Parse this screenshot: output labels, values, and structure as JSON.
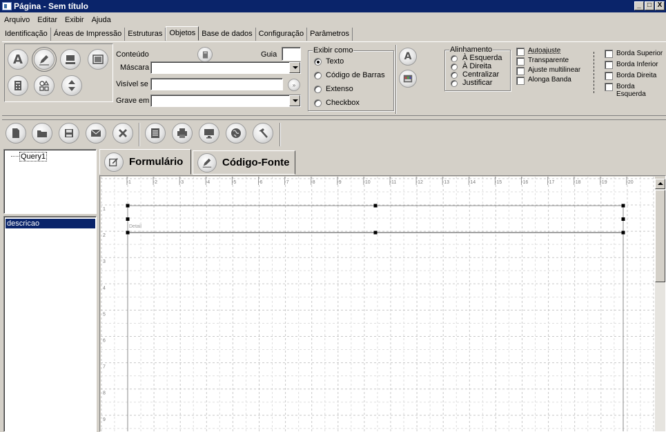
{
  "window": {
    "title": "Página - Sem título"
  },
  "window_buttons": [
    "_",
    "□",
    "X"
  ],
  "menu": [
    "Arquivo",
    "Editar",
    "Exibir",
    "Ajuda"
  ],
  "tabs": [
    "Identificação",
    "Áreas de Impressão",
    "Estruturas",
    "Objetos",
    "Base de dados",
    "Configuração",
    "Parâmetros"
  ],
  "active_tab": "Objetos",
  "object_tools": [
    "text-tool",
    "pencil-tool",
    "computer-tool",
    "image-tool",
    "calculator-tool",
    "shapes-tool",
    "arrows-tool"
  ],
  "props": {
    "conteudo_label": "Conteúdo",
    "guia_label": "Guia",
    "mascara_label": "Máscara",
    "visivel_label": "Visível se",
    "grave_label": "Grave em"
  },
  "exibir": {
    "legend": "Exibir como",
    "options": [
      "Texto",
      "Código de Barras",
      "Extenso",
      "Checkbox"
    ],
    "selected": "Texto"
  },
  "alinhamento": {
    "legend": "Alinhamento",
    "options": [
      "À Esquerda",
      "À Direita",
      "Centralizar",
      "Justificar"
    ]
  },
  "checks": [
    "Autoajuste",
    "Transparente",
    "Ajuste multilinear",
    "Alonga Banda"
  ],
  "bordas": [
    "Borda Superior",
    "Borda Inferior",
    "Borda Direita",
    "Borda Esquerda"
  ],
  "toolbar": [
    "new-icon",
    "open-icon",
    "save-icon",
    "mail-icon",
    "close-icon",
    "print-preview-icon",
    "print-icon",
    "monitor-icon",
    "globe-icon",
    "hammer-icon"
  ],
  "tree": {
    "items": [
      "Query1"
    ]
  },
  "fields_list": {
    "items": [
      "descricao"
    ]
  },
  "editor_tabs": [
    "Formulário",
    "Código-Fonte"
  ],
  "ruler": {
    "numbers": [
      "1",
      "2",
      "3",
      "4",
      "5",
      "6",
      "7",
      "8",
      "9",
      "10",
      "11",
      "12",
      "13",
      "14",
      "15",
      "16",
      "17",
      "18",
      "19",
      "20"
    ],
    "vnumbers": [
      "1",
      "2",
      "3",
      "4",
      "5",
      "6",
      "7",
      "8",
      "9"
    ]
  },
  "band": {
    "label": "Detail"
  }
}
